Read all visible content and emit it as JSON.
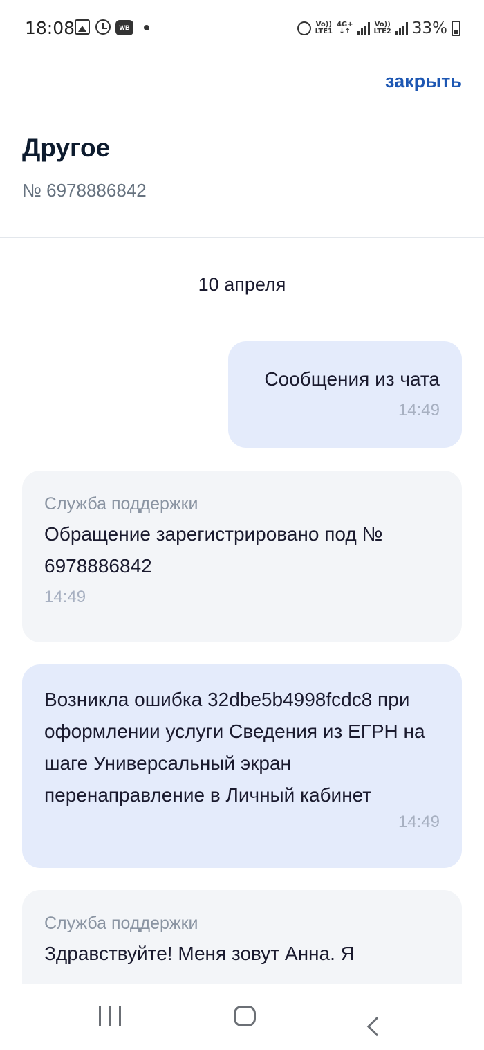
{
  "status_bar": {
    "time": "18:08",
    "icons_left": [
      "gallery-icon",
      "alarm-icon",
      "wb-icon",
      "dot-icon"
    ],
    "network1_top": "Vo))",
    "network1_bottom": "LTE1",
    "network_type_top": "4G+",
    "network_type_bottom": "↓↑",
    "network2_top": "Vo))",
    "network2_bottom": "LTE2",
    "wb_label": "WB",
    "battery": "33%"
  },
  "header": {
    "close_label": "закрыть",
    "title": "Другое",
    "number": "№ 6978886842"
  },
  "chat": {
    "date": "10 апреля",
    "messages": [
      {
        "from": "user",
        "text": "Сообщения из чата",
        "time": "14:49"
      },
      {
        "from": "support",
        "sender": "Служба поддержки",
        "text": "Обращение зарегистрировано под № 6978886842",
        "time": "14:49"
      },
      {
        "from": "user",
        "text": "Возникла ошибка 32dbe5b4998fcdc8 при оформлении услуги Сведения из ЕГРН на шаге Универсальный экран перенаправление в Личный кабинет",
        "time": "14:49"
      },
      {
        "from": "support",
        "sender": "Служба поддержки",
        "text": "Здравствуйте! Меня зовут Анна. Я",
        "time": ""
      }
    ]
  },
  "colors": {
    "accent": "#1d57b3",
    "user_bubble": "#e4ebfb",
    "support_bubble": "#f3f5f8"
  }
}
